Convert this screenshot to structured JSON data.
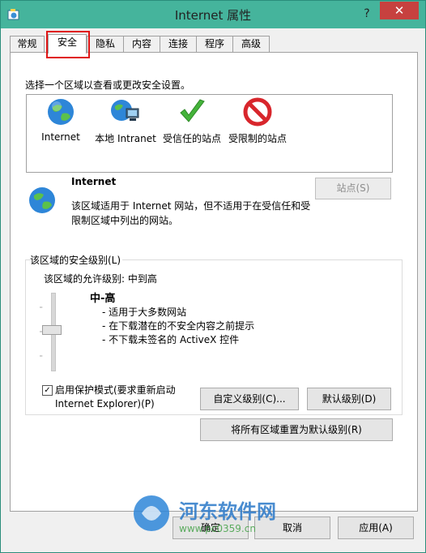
{
  "window": {
    "title": "Internet 属性",
    "help_label": "?",
    "close_label": "✕",
    "accent_color": "#45b49c",
    "close_color": "#c7413f"
  },
  "tabs": [
    {
      "label": "常规"
    },
    {
      "label": "安全"
    },
    {
      "label": "隐私"
    },
    {
      "label": "内容"
    },
    {
      "label": "连接"
    },
    {
      "label": "程序"
    },
    {
      "label": "高级"
    }
  ],
  "security": {
    "zone_caption": "选择一个区域以查看或更改安全设置。",
    "zones": [
      {
        "label": "Internet",
        "icon": "globe-icon"
      },
      {
        "label": "本地 Intranet",
        "icon": "intranet-icon"
      },
      {
        "label": "受信任的站点",
        "icon": "checkmark-icon"
      },
      {
        "label": "受限制的站点",
        "icon": "restricted-icon"
      }
    ],
    "selected_zone": {
      "title": "Internet",
      "description": "该区域适用于 Internet 网站，但不适用于在受信任和受限制区域中列出的网站。",
      "sites_button": "站点(S)"
    },
    "level": {
      "group_label": "该区域的安全级别(L)",
      "allowed": "该区域的允许级别: 中到高",
      "name": "中-高",
      "bullets": [
        "- 适用于大多数网站",
        "- 在下载潜在的不安全内容之前提示",
        "- 不下载未签名的 ActiveX 控件"
      ],
      "slider_position": "中-高"
    },
    "protected_mode": {
      "label": "启用保护模式(要求重新启动 Internet Explorer)(P)",
      "checked": true,
      "check_glyph": "✓"
    },
    "custom_level_button": "自定义级别(C)...",
    "default_level_button": "默认级别(D)",
    "reset_all_button": "将所有区域重置为默认级别(R)"
  },
  "footer": {
    "ok": "确定",
    "cancel": "取消",
    "apply": "应用(A)"
  },
  "watermark": {
    "name": "河东软件网",
    "url": "www.pc0359.cn"
  }
}
